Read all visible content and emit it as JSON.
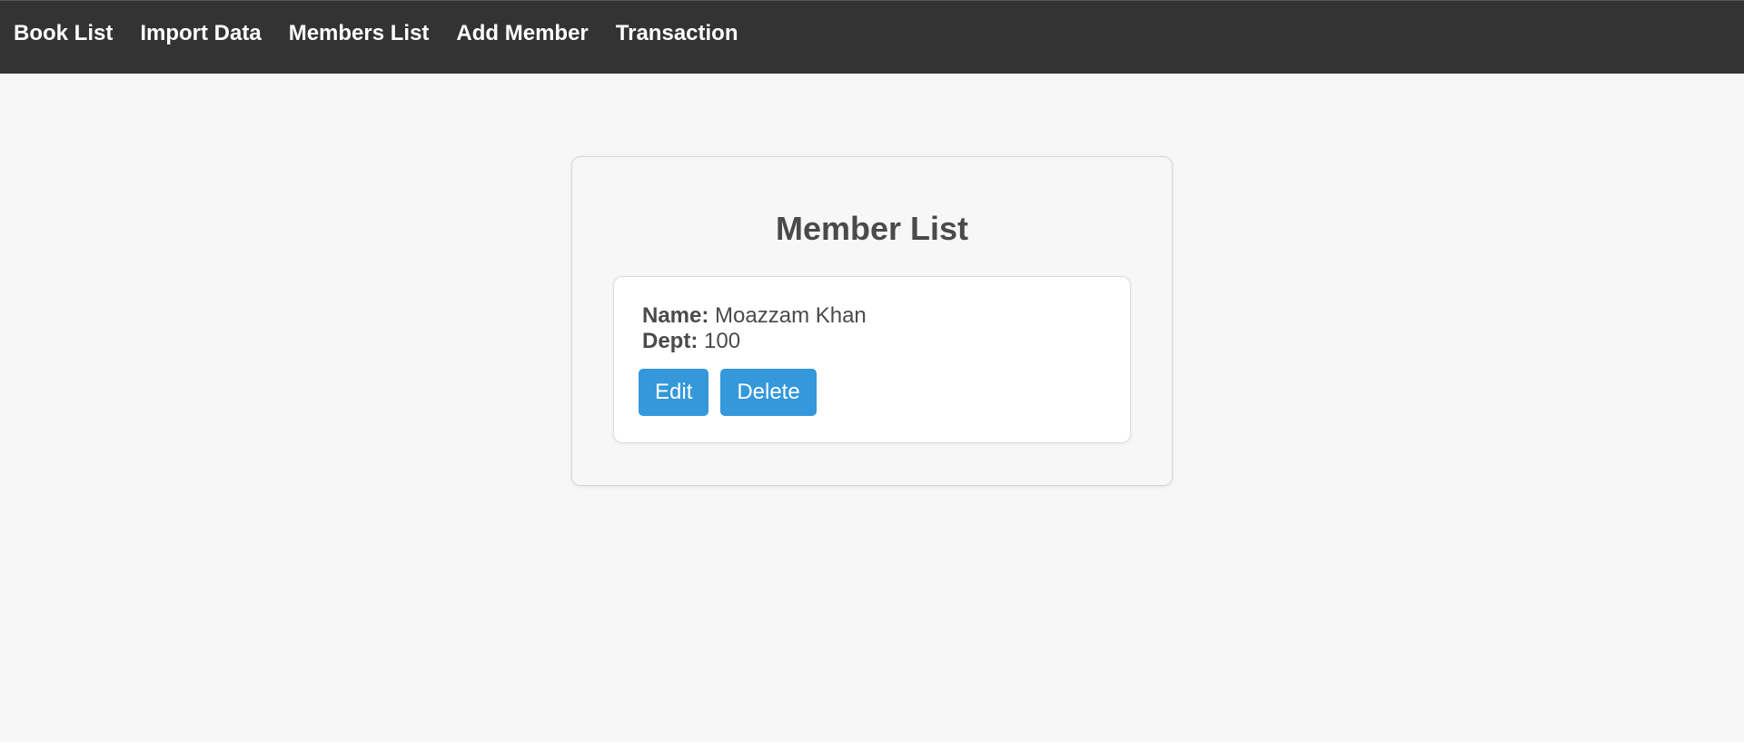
{
  "nav": {
    "items": [
      {
        "label": "Book List"
      },
      {
        "label": "Import Data"
      },
      {
        "label": "Members List"
      },
      {
        "label": "Add Member"
      },
      {
        "label": "Transaction"
      }
    ]
  },
  "main": {
    "title": "Member List",
    "members": [
      {
        "name_label": "Name:",
        "name": "Moazzam Khan",
        "dept_label": "Dept:",
        "dept": "100",
        "edit_label": "Edit",
        "delete_label": "Delete"
      }
    ]
  },
  "colors": {
    "navbar_bg": "#333333",
    "page_bg": "#f7f7f7",
    "button_bg": "#3498db",
    "button_text": "#ffffff"
  }
}
